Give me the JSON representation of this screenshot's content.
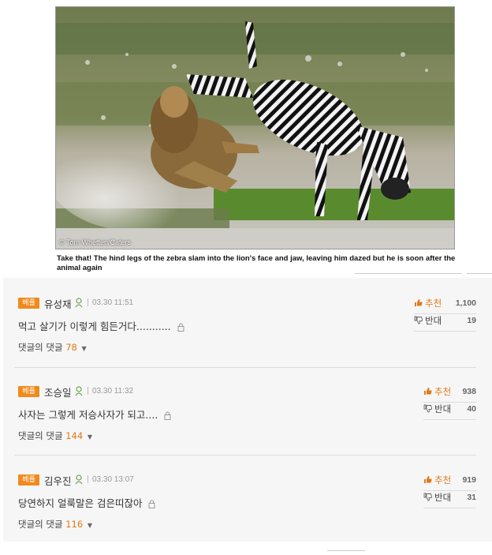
{
  "photo": {
    "credit": "© Tom Whetten/Caters",
    "caption": "Take that! The hind legs of the zebra slam into the lion's face and jaw, leaving him dazed but he is soon after the animal again"
  },
  "comments": [
    {
      "badge": "베플",
      "author": "유성재",
      "time": "03.30 11:51",
      "body": "먹고 살기가 이렇게 힘든거다...........",
      "replies_label": "댓글의 댓글",
      "replies_count": "78",
      "up_label": "추천",
      "up_count": "1,100",
      "down_label": "반대",
      "down_count": "19"
    },
    {
      "badge": "베플",
      "author": "조승일",
      "time": "03.30 11:32",
      "body": "사자는 그렇게 저승사자가 되고....",
      "replies_label": "댓글의 댓글",
      "replies_count": "144",
      "up_label": "추천",
      "up_count": "938",
      "down_label": "반대",
      "down_count": "40"
    },
    {
      "badge": "베플",
      "author": "김우진",
      "time": "03.30 13:07",
      "body": "당연하지 얼룩말은 검은띠잖아",
      "replies_label": "댓글의 댓글",
      "replies_count": "116",
      "up_label": "추천",
      "up_count": "919",
      "down_label": "반대",
      "down_count": "31"
    }
  ],
  "colors": {
    "accent": "#f08a1e",
    "reply_count": "#e07a1a",
    "panel_bg": "#f6f6f6"
  },
  "icons": [
    "user-icon",
    "lock-icon",
    "thumbs-up-icon",
    "thumbs-down-icon",
    "caret-down-icon"
  ]
}
